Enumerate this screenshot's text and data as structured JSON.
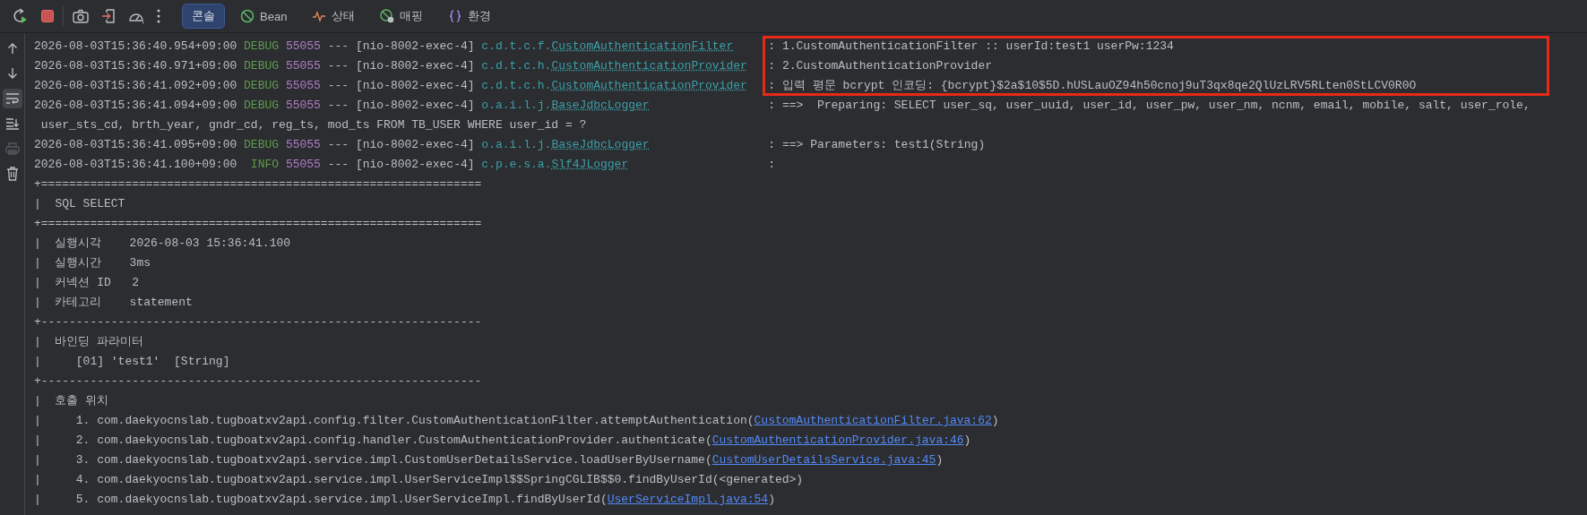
{
  "toolbar": {
    "tabs": [
      {
        "label": "콘솔",
        "kind": "console",
        "selected": true
      },
      {
        "label": "Bean",
        "kind": "bean",
        "selected": false
      },
      {
        "label": "상태",
        "kind": "health",
        "selected": false
      },
      {
        "label": "매핑",
        "kind": "mapping",
        "selected": false
      },
      {
        "label": "환경",
        "kind": "env",
        "selected": false
      }
    ]
  },
  "sidebar": {
    "soft_wrap_on": true,
    "print_disabled": true
  },
  "console": {
    "lines": [
      {
        "kind": "log",
        "timestamp": "2026-08-03T15:36:40.954+09:00",
        "level": "DEBUG",
        "pid": "55055",
        "separator": "---",
        "thread": "[nio-8002-exec-4]",
        "logger_package": "c.d.t.c.f.",
        "logger_class": "CustomAuthenticationFilter",
        "message": ": 1.CustomAuthenticationFilter :: userId:test1 userPw:1234",
        "highlighted": true
      },
      {
        "kind": "log",
        "timestamp": "2026-08-03T15:36:40.971+09:00",
        "level": "DEBUG",
        "pid": "55055",
        "separator": "---",
        "thread": "[nio-8002-exec-4]",
        "logger_package": "c.d.t.c.h.",
        "logger_class": "CustomAuthenticationProvider",
        "message": ": 2.CustomAuthenticationProvider",
        "highlighted": true
      },
      {
        "kind": "log",
        "timestamp": "2026-08-03T15:36:41.092+09:00",
        "level": "DEBUG",
        "pid": "55055",
        "separator": "---",
        "thread": "[nio-8002-exec-4]",
        "logger_package": "c.d.t.c.h.",
        "logger_class": "CustomAuthenticationProvider",
        "message": ": 입력 평문 bcrypt 인코딩: {bcrypt}$2a$10$5D.hUSLauOZ94h50cnoj9uT3qx8qe2QlUzLRV5RLten0StLCV0R0O",
        "highlighted": true
      },
      {
        "kind": "log",
        "timestamp": "2026-08-03T15:36:41.094+09:00",
        "level": "DEBUG",
        "pid": "55055",
        "separator": "---",
        "thread": "[nio-8002-exec-4]",
        "logger_package": "o.a.i.l.j.",
        "logger_class": "BaseJdbcLogger",
        "message": ": ==>  Preparing: SELECT user_sq, user_uuid, user_id, user_pw, user_nm, ncnm, email, mobile, salt, user_role,",
        "highlighted": false
      },
      {
        "kind": "wrap",
        "text": "user_sts_cd, brth_year, gndr_cd, reg_ts, mod_ts FROM TB_USER WHERE user_id = ?"
      },
      {
        "kind": "log",
        "timestamp": "2026-08-03T15:36:41.095+09:00",
        "level": "DEBUG",
        "pid": "55055",
        "separator": "---",
        "thread": "[nio-8002-exec-4]",
        "logger_package": "o.a.i.l.j.",
        "logger_class": "BaseJdbcLogger",
        "message": ": ==> Parameters: test1(String)",
        "highlighted": false
      },
      {
        "kind": "log",
        "timestamp": "2026-08-03T15:36:41.100+09:00",
        "level": "INFO",
        "pid": "55055",
        "separator": "---",
        "thread": "[nio-8002-exec-4]",
        "logger_package": "c.p.e.s.a.",
        "logger_class": "Slf4JLogger",
        "message": ":",
        "highlighted": false
      },
      {
        "kind": "text",
        "text": "+==============================================================="
      },
      {
        "kind": "text",
        "text": "|  SQL SELECT"
      },
      {
        "kind": "text",
        "text": "+==============================================================="
      },
      {
        "kind": "text",
        "text": "|  실행시각    2026-08-03 15:36:41.100"
      },
      {
        "kind": "text",
        "text": "|  실행시간    3ms"
      },
      {
        "kind": "text",
        "text": "|  커넥션 ID   2"
      },
      {
        "kind": "text",
        "text": "|  카테고리    statement"
      },
      {
        "kind": "text",
        "text": "+---------------------------------------------------------------"
      },
      {
        "kind": "text",
        "text": "|  바인딩 파라미터"
      },
      {
        "kind": "text",
        "text": "|     [01] 'test1'  [String]"
      },
      {
        "kind": "text",
        "text": "+---------------------------------------------------------------"
      },
      {
        "kind": "text",
        "text": "|  호출 위치"
      },
      {
        "kind": "trace",
        "text": "|     1. com.daekyocnslab.tugboatxv2api.config.filter.CustomAuthenticationFilter.attemptAuthentication(",
        "link": "CustomAuthenticationFilter.java:62",
        "suffix": ")"
      },
      {
        "kind": "trace",
        "text": "|     2. com.daekyocnslab.tugboatxv2api.config.handler.CustomAuthenticationProvider.authenticate(",
        "link": "CustomAuthenticationProvider.java:46",
        "suffix": ")"
      },
      {
        "kind": "trace",
        "text": "|     3. com.daekyocnslab.tugboatxv2api.service.impl.CustomUserDetailsService.loadUserByUsername(",
        "link": "CustomUserDetailsService.java:45",
        "suffix": ")"
      },
      {
        "kind": "text",
        "text": "|     4. com.daekyocnslab.tugboatxv2api.service.impl.UserServiceImpl$$SpringCGLIB$$0.findByUserId(<generated>)"
      },
      {
        "kind": "trace",
        "text": "|     5. com.daekyocnslab.tugboatxv2api.service.impl.UserServiceImpl.findByUserId(",
        "link": "UserServiceImpl.java:54",
        "suffix": ")"
      }
    ]
  }
}
